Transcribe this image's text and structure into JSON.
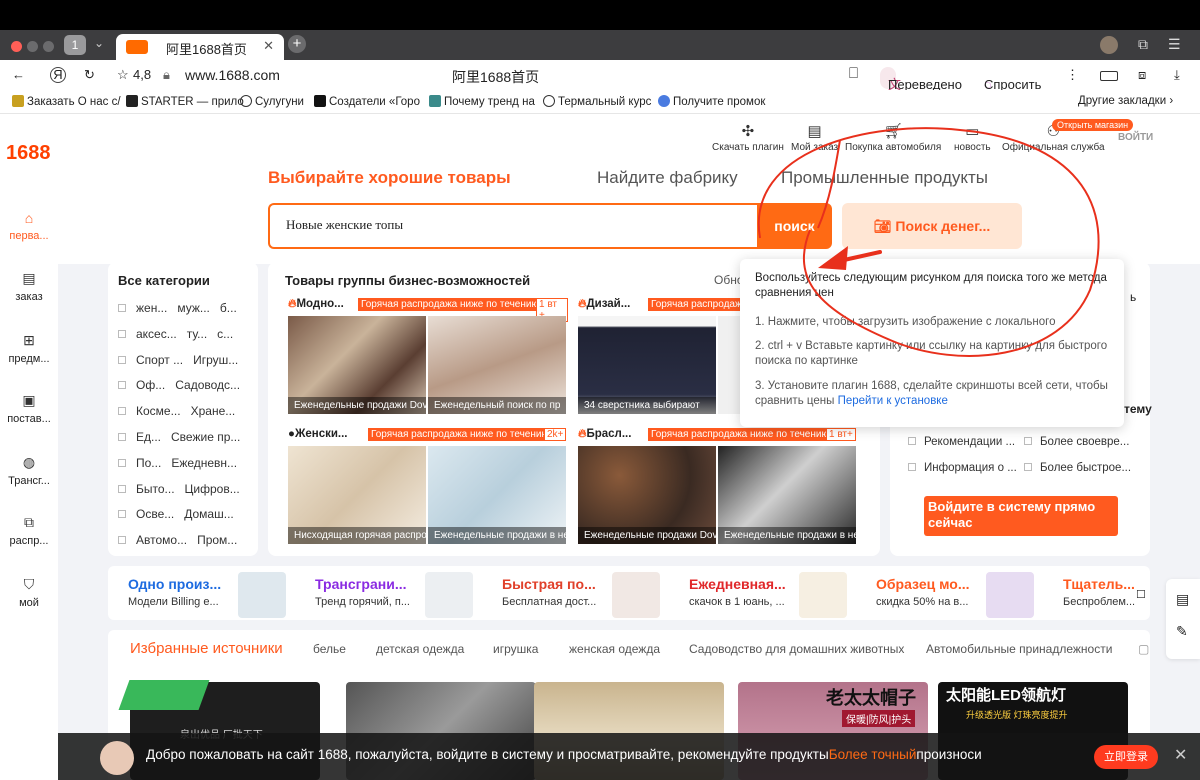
{
  "browser": {
    "tab_count": "1",
    "tab_title": "阿里1688首页",
    "rating": "4,8",
    "url": "www.1688.com",
    "page_title": "阿里1688首页",
    "translated": "Переведено",
    "ask": "Спросить",
    "bookmarks": [
      "Заказать О нас с/",
      "STARTER — прило",
      "Сулугуни",
      "Создатели «Горо",
      "Почему тренд на",
      "Термальный курс",
      "Получите промок"
    ],
    "other_bookmarks": "Другие закладки"
  },
  "sidebar": {
    "logo": "1688",
    "items": [
      {
        "label": "перва...",
        "icon": "home-icon"
      },
      {
        "label": "заказ",
        "icon": "clipboard-icon"
      },
      {
        "label": "предм...",
        "icon": "grid-icon"
      },
      {
        "label": "постав...",
        "icon": "supplier-icon"
      },
      {
        "label": "Трансг...",
        "icon": "globe-icon"
      },
      {
        "label": "распр...",
        "icon": "distribution-icon"
      },
      {
        "label": "мой",
        "icon": "user-shield-icon"
      }
    ]
  },
  "header": {
    "icons": [
      {
        "label": "Скачать плагин",
        "icon": "plugin-icon"
      },
      {
        "label": "Мой заказ",
        "icon": "order-icon"
      },
      {
        "label": "Покупка автомобиля",
        "icon": "cart-icon"
      },
      {
        "label": "новость",
        "icon": "message-icon"
      },
      {
        "label": "Официальная служба",
        "icon": "service-icon"
      }
    ],
    "open_shop": "Открыть магазин",
    "login": "ВОЙТИ"
  },
  "search": {
    "tabs": [
      "Выбирайте хорошие товары",
      "Найдите фабрику",
      "Промышленные продукты"
    ],
    "query": "Новые женские топы",
    "button": "поиск",
    "image_search": "Поиск денег..."
  },
  "categories": {
    "title": "Все категории",
    "rows": [
      [
        "жен...",
        "муж...",
        "б..."
      ],
      [
        "аксес...",
        "ту...",
        "с..."
      ],
      [
        "Спорт ...",
        "Игруш..."
      ],
      [
        "Оф...",
        "Садоводс..."
      ],
      [
        "Косме...",
        "Хране..."
      ],
      [
        "Ед...",
        "Свежие пр..."
      ],
      [
        "По...",
        "Ежедневн..."
      ],
      [
        "Быто...",
        "Цифров..."
      ],
      [
        "Осве...",
        "Домаш..."
      ],
      [
        "Автомо...",
        "Пром..."
      ]
    ]
  },
  "business": {
    "title": "Товары группы бизнес-возможностей",
    "update": "Обно",
    "cards": [
      {
        "title": "Модно...",
        "tag": "Горячая распродажа ниже по течению",
        "num": "1 вт +",
        "captions": [
          "Еженедельные продажи Dov",
          "Еженедельный поиск по пр"
        ]
      },
      {
        "title": "Дизай...",
        "tag": "Горячая распродажа ниже по течению",
        "num": "",
        "captions": [
          "34 сверстника выбирают",
          ""
        ]
      },
      {
        "title": "Женски...",
        "tag": "Горячая распродажа ниже по течению",
        "num": "2k+",
        "captions": [
          "Нисходящая горячая распро",
          "Еженедельные продажи в не"
        ]
      },
      {
        "title": "Брасл...",
        "tag": "Горячая распродажа ниже по течению",
        "num": "1 вт+",
        "captions": [
          "Еженедельные продажи Dov",
          "Еженедельные продажи в не"
        ]
      }
    ]
  },
  "popup": {
    "intro": "Воспользуйтесь следующим рисунком для поиска того же метода сравнения цен",
    "step1": "1. Нажмите, чтобы загрузить изображение с локального",
    "step2": "2. ctrl + v Вставьте картинку или ссылку на картинку для быстрого поиска по картинке",
    "step3": "3. Установите плагин 1688, сделайте скриншоты всей сети, чтобы сравнить цены",
    "link": "Перейти к установке"
  },
  "right_panel": {
    "partial_top": "ь",
    "partial_mid": "тему",
    "items": [
      "Рекомендации ...",
      "Более своевре...",
      "Информация о ...",
      "Более быстрое..."
    ],
    "login_button": "Войдите в систему прямо сейчас"
  },
  "strip": [
    {
      "title": "Одно произ...",
      "sub": "Модели Billing e...",
      "color": "#1d6be0"
    },
    {
      "title": "Трансграни...",
      "sub": "Тренд горячий, п...",
      "color": "#8a2be2"
    },
    {
      "title": "Быстрая по...",
      "sub": "Бесплатная дост...",
      "color": "#e0402a"
    },
    {
      "title": "Ежедневная...",
      "sub": "скачок в 1 юань, ...",
      "color": "#e0282a"
    },
    {
      "title": "Образец мо...",
      "sub": "скидка 50% на в...",
      "color": "#ff5a1f"
    },
    {
      "title": "Тщатель...",
      "sub": "Беспроблем...",
      "color": "#ff5a1f"
    }
  ],
  "sources": {
    "title": "Избранные источники",
    "categories": [
      "белье",
      "детская одежда",
      "игрушка",
      "женская одежда",
      "Садоводство для домашних животных",
      "Автомобильные принадлежности"
    ],
    "banners": [
      "老太太帽子",
      "保暖|防风|护头",
      "太阳能LED领航灯",
      "升级透光版 灯珠亮度提升",
      "泉出优品 厂批天下"
    ]
  },
  "welcome": {
    "text": "Добро пожаловать на сайт 1688, пожалуйста, войдите в систему и просматривайте, рекомендуйте продукты",
    "highlight": "Более точный",
    "tail": "произноси",
    "button": "立即登录"
  },
  "colors": {
    "accent": "#ff5a1f",
    "annotation": "#e8301c",
    "link": "#1d6be0"
  }
}
